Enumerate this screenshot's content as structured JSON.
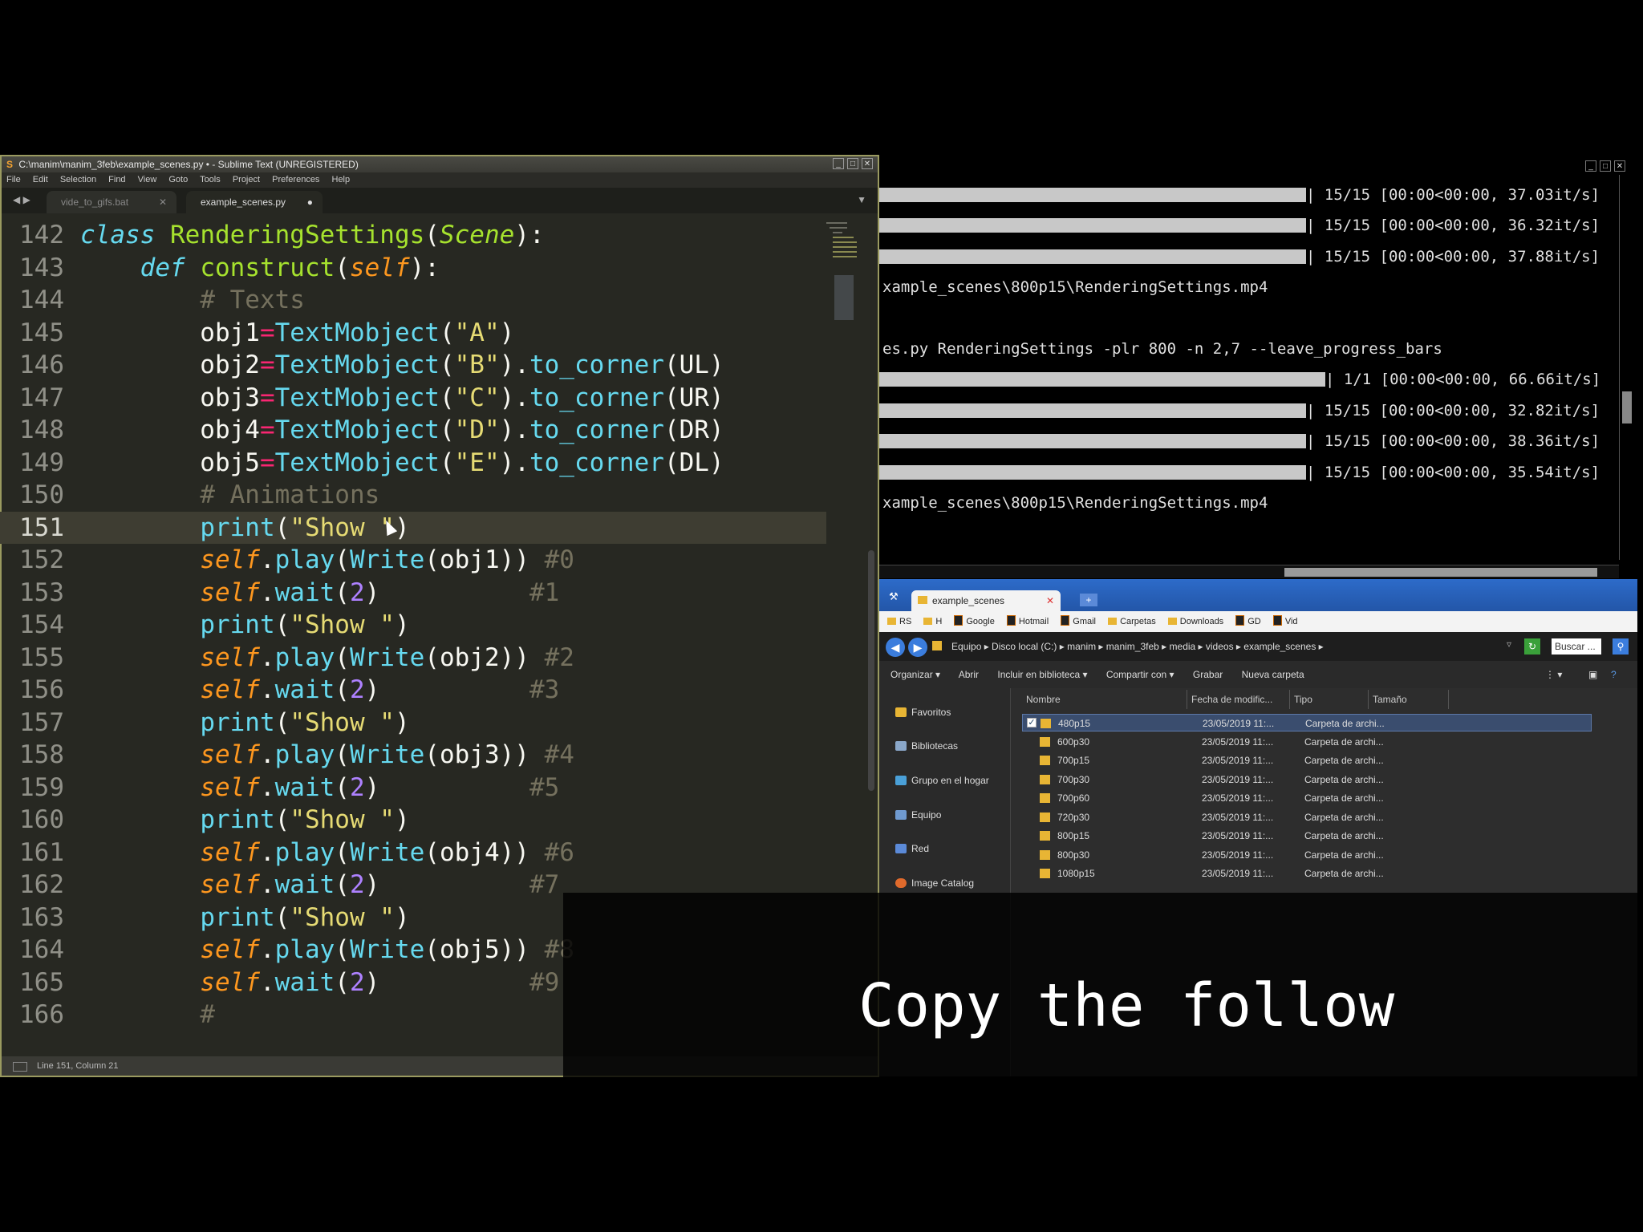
{
  "sublime": {
    "title": "C:\\manim\\manim_3feb\\example_scenes.py • - Sublime Text (UNREGISTERED)",
    "menu": [
      "File",
      "Edit",
      "Selection",
      "Find",
      "View",
      "Goto",
      "Tools",
      "Project",
      "Preferences",
      "Help"
    ],
    "tabs": [
      {
        "label": "vide_to_gifs.bat",
        "active": false
      },
      {
        "label": "example_scenes.py",
        "active": true
      }
    ],
    "status": "Line 151, Column 21",
    "lines": [
      "142",
      "143",
      "144",
      "145",
      "146",
      "147",
      "148",
      "149",
      "150",
      "151",
      "152",
      "153",
      "154",
      "155",
      "156",
      "157",
      "158",
      "159",
      "160",
      "161",
      "162",
      "163",
      "164",
      "165",
      "166"
    ]
  },
  "terminal": {
    "lines": [
      {
        "text": "| 15/15 [00:00<00:00, 37.03it/s]",
        "bar": true,
        "progress": 1.0
      },
      {
        "text": "| 15/15 [00:00<00:00, 36.32it/s]",
        "bar": true,
        "progress": 1.0
      },
      {
        "text": "| 15/15 [00:00<00:00, 37.88it/s]",
        "bar": true,
        "progress": 1.0
      },
      {
        "text": "xample_scenes\\800p15\\RenderingSettings.mp4",
        "bar": false
      },
      {
        "text": "",
        "bar": false
      },
      {
        "text": "es.py RenderingSettings -plr 800 -n 2,7 --leave_progress_bars",
        "bar": false
      },
      {
        "text": "| 1/1 [00:00<00:00, 66.66it/s]",
        "bar": true,
        "progress": 1.0
      },
      {
        "text": "| 15/15 [00:00<00:00, 32.82it/s]",
        "bar": true,
        "progress": 1.0
      },
      {
        "text": "| 15/15 [00:00<00:00, 38.36it/s]",
        "bar": true,
        "progress": 1.0
      },
      {
        "text": "| 15/15 [00:00<00:00, 35.54it/s]",
        "bar": true,
        "progress": 1.0
      },
      {
        "text": "xample_scenes\\800p15\\RenderingSettings.mp4",
        "bar": false
      }
    ]
  },
  "explorer": {
    "tab_title": "example_scenes",
    "bookmarks": [
      "RS",
      "H",
      "Google",
      "Hotmail",
      "Gmail",
      "Carpetas",
      "Downloads",
      "GD",
      "Vid"
    ],
    "breadcrumb": "Equipo ▸ Disco local (C:) ▸ manim ▸ manim_3feb ▸ media ▸ videos ▸ example_scenes ▸",
    "search_placeholder": "Buscar ...",
    "toolbar": [
      "Organizar ▾",
      "Abrir",
      "Incluir en biblioteca ▾",
      "Compartir con ▾",
      "Grabar",
      "Nueva carpeta"
    ],
    "nav": [
      "Favoritos",
      "Bibliotecas",
      "Grupo en el hogar",
      "Equipo",
      "Red",
      "Image Catalog"
    ],
    "columns": [
      "Nombre",
      "Fecha de modific...",
      "Tipo",
      "Tamaño"
    ],
    "rows": [
      {
        "name": "480p15",
        "date": "23/05/2019 11:...",
        "type": "Carpeta de archi..."
      },
      {
        "name": "600p30",
        "date": "23/05/2019 11:...",
        "type": "Carpeta de archi..."
      },
      {
        "name": "700p15",
        "date": "23/05/2019 11:...",
        "type": "Carpeta de archi..."
      },
      {
        "name": "700p30",
        "date": "23/05/2019 11:...",
        "type": "Carpeta de archi..."
      },
      {
        "name": "700p60",
        "date": "23/05/2019 11:...",
        "type": "Carpeta de archi..."
      },
      {
        "name": "720p30",
        "date": "23/05/2019 11:...",
        "type": "Carpeta de archi..."
      },
      {
        "name": "800p15",
        "date": "23/05/2019 11:...",
        "type": "Carpeta de archi..."
      },
      {
        "name": "800p30",
        "date": "23/05/2019 11:...",
        "type": "Carpeta de archi..."
      },
      {
        "name": "1080p15",
        "date": "23/05/2019 11:...",
        "type": "Carpeta de archi..."
      }
    ]
  },
  "caption": "Copy the follow"
}
